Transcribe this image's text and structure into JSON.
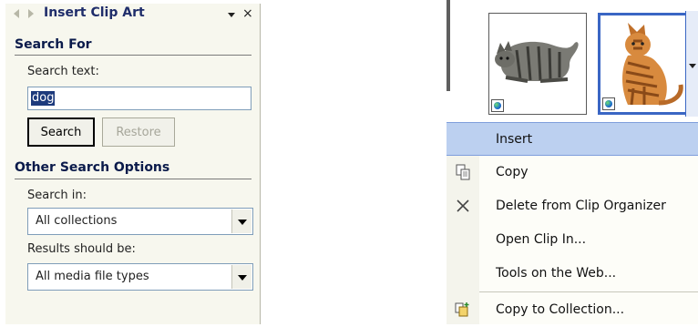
{
  "task_pane": {
    "title": "Insert Clip Art",
    "close_glyph": "×",
    "search_for": {
      "heading": "Search For",
      "search_text_label": "Search text:",
      "search_text_value": "dog",
      "search_button": "Search",
      "restore_button": "Restore"
    },
    "other_options": {
      "heading": "Other Search Options",
      "search_in_label": "Search in:",
      "search_in_value": "All collections",
      "results_label": "Results should be:",
      "results_value": "All media file types"
    }
  },
  "gallery": {
    "clips": [
      {
        "name": "tabby-cat-lying",
        "badge_icon": "globe-icon"
      },
      {
        "name": "orange-cat-sitting",
        "badge_icon": "globe-icon",
        "selected": true
      }
    ],
    "selection_color": "#3a66c4"
  },
  "context_menu": {
    "items": [
      {
        "label": "Insert",
        "highlighted": true
      },
      {
        "label": "Copy",
        "icon": "copy-icon"
      },
      {
        "label": "Delete from Clip Organizer",
        "icon": "delete-icon"
      },
      {
        "label": "Open Clip In..."
      },
      {
        "label": "Tools on the Web..."
      },
      {
        "label": "Copy to Collection...",
        "icon": "copy-to-collection-icon"
      }
    ],
    "highlight_color": "#bcd0f0"
  }
}
